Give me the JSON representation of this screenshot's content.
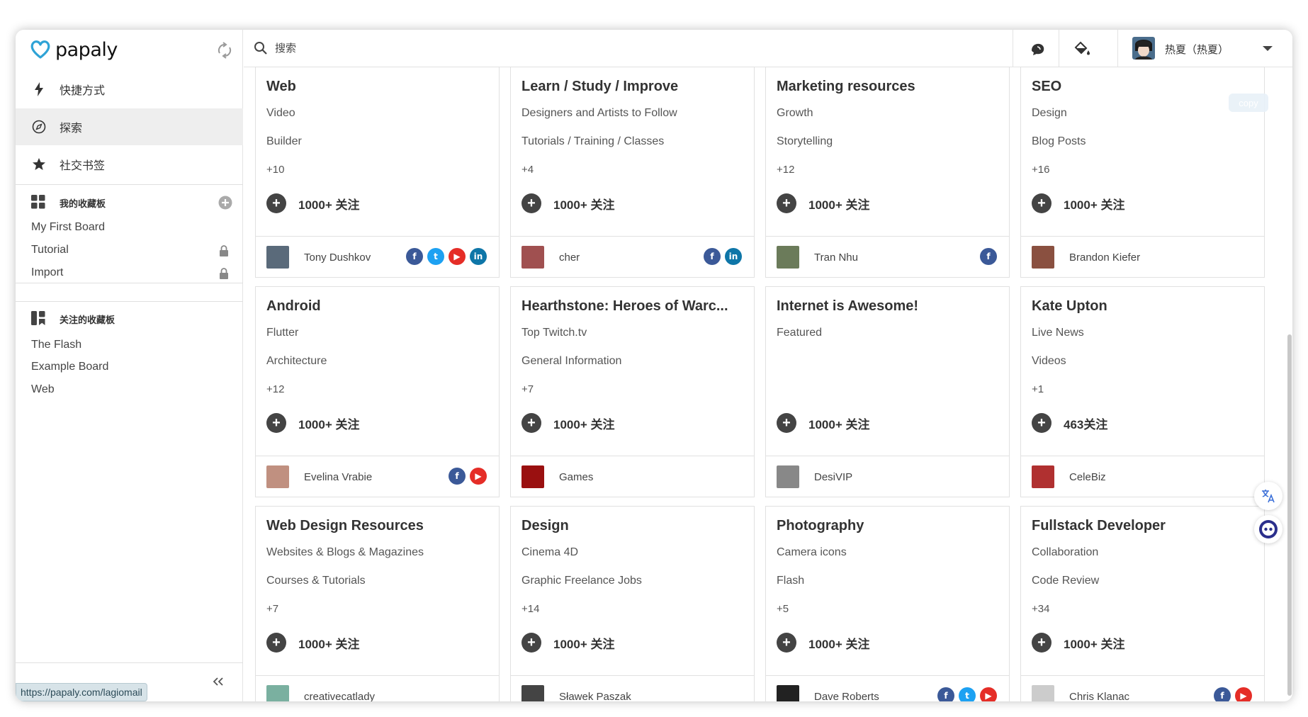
{
  "app": {
    "logo_text": "papaly"
  },
  "sidebar": {
    "nav": [
      {
        "label": "快捷方式",
        "icon": "lightning-icon"
      },
      {
        "label": "探索",
        "icon": "compass-icon"
      },
      {
        "label": "社交书签",
        "icon": "star-icon"
      }
    ],
    "my_boards_title": "我的收藏板",
    "my_boards": [
      {
        "label": "My First Board",
        "locked": false
      },
      {
        "label": "Tutorial",
        "locked": true
      },
      {
        "label": "Import",
        "locked": true
      }
    ],
    "followed_title": "关注的收藏板",
    "followed": [
      {
        "label": "The Flash"
      },
      {
        "label": "Example Board"
      },
      {
        "label": "Web"
      }
    ],
    "status_url": "https://papaly.com/lagiomail"
  },
  "topbar": {
    "search_placeholder": "搜索",
    "user_name": "热夏（热夏）"
  },
  "colors": {
    "facebook": "#3b5998",
    "twitter": "#1da1f2",
    "youtube": "#e52d27",
    "linkedin": "#0e76a8",
    "follow_button": "#444444"
  },
  "cards": [
    {
      "title": "Web",
      "items": [
        "Video",
        "Builder"
      ],
      "more": "+10",
      "follow": "1000+ 关注",
      "owner": "Tony Dushkov",
      "social": [
        "facebook",
        "twitter",
        "youtube",
        "linkedin"
      ]
    },
    {
      "title": "Learn / Study / Improve",
      "items": [
        "Designers and Artists to Follow",
        "Tutorials / Training / Classes"
      ],
      "more": "+4",
      "follow": "1000+ 关注",
      "owner": "cher",
      "social": [
        "facebook",
        "linkedin"
      ]
    },
    {
      "title": "Marketing resources",
      "items": [
        "Growth",
        "Storytelling"
      ],
      "more": "+12",
      "follow": "1000+ 关注",
      "owner": "Tran Nhu",
      "social": [
        "facebook"
      ]
    },
    {
      "title": "SEO",
      "items": [
        "Design",
        "Blog Posts"
      ],
      "more": "+16",
      "follow": "1000+ 关注",
      "owner": "Brandon Kiefer",
      "social": []
    },
    {
      "title": "Android",
      "items": [
        "Flutter",
        "Architecture"
      ],
      "more": "+12",
      "follow": "1000+ 关注",
      "owner": "Evelina Vrabie",
      "social": [
        "facebook",
        "youtube"
      ]
    },
    {
      "title": "Hearthstone: Heroes of Warc...",
      "items": [
        "Top Twitch.tv",
        "General Information"
      ],
      "more": "+7",
      "follow": "1000+ 关注",
      "owner": "Games",
      "social": []
    },
    {
      "title": "Internet is Awesome!",
      "items": [
        "Featured"
      ],
      "more": "",
      "follow": "1000+ 关注",
      "owner": "DesiVIP",
      "social": []
    },
    {
      "title": "Kate Upton",
      "items": [
        "Live News",
        "Videos"
      ],
      "more": "+1",
      "follow": "463关注",
      "owner": "CeleBiz",
      "social": []
    },
    {
      "title": "Web Design Resources",
      "items": [
        "Websites & Blogs & Magazines",
        "Courses & Tutorials"
      ],
      "more": "+7",
      "follow": "1000+ 关注",
      "owner": "creativecatlady",
      "social": []
    },
    {
      "title": "Design",
      "items": [
        "Cinema 4D",
        "Graphic Freelance Jobs"
      ],
      "more": "+14",
      "follow": "1000+ 关注",
      "owner": "Sławek Paszak",
      "social": []
    },
    {
      "title": "Photography",
      "items": [
        "Camera icons",
        "Flash"
      ],
      "more": "+5",
      "follow": "1000+ 关注",
      "owner": "Dave Roberts",
      "social": [
        "facebook",
        "twitter",
        "youtube"
      ]
    },
    {
      "title": "Fullstack Developer",
      "items": [
        "Collaboration",
        "Code Review"
      ],
      "more": "+34",
      "follow": "1000+ 关注",
      "owner": "Chris Klanac",
      "social": [
        "facebook",
        "youtube"
      ]
    }
  ],
  "overlay": {
    "copy_label": "copy"
  }
}
